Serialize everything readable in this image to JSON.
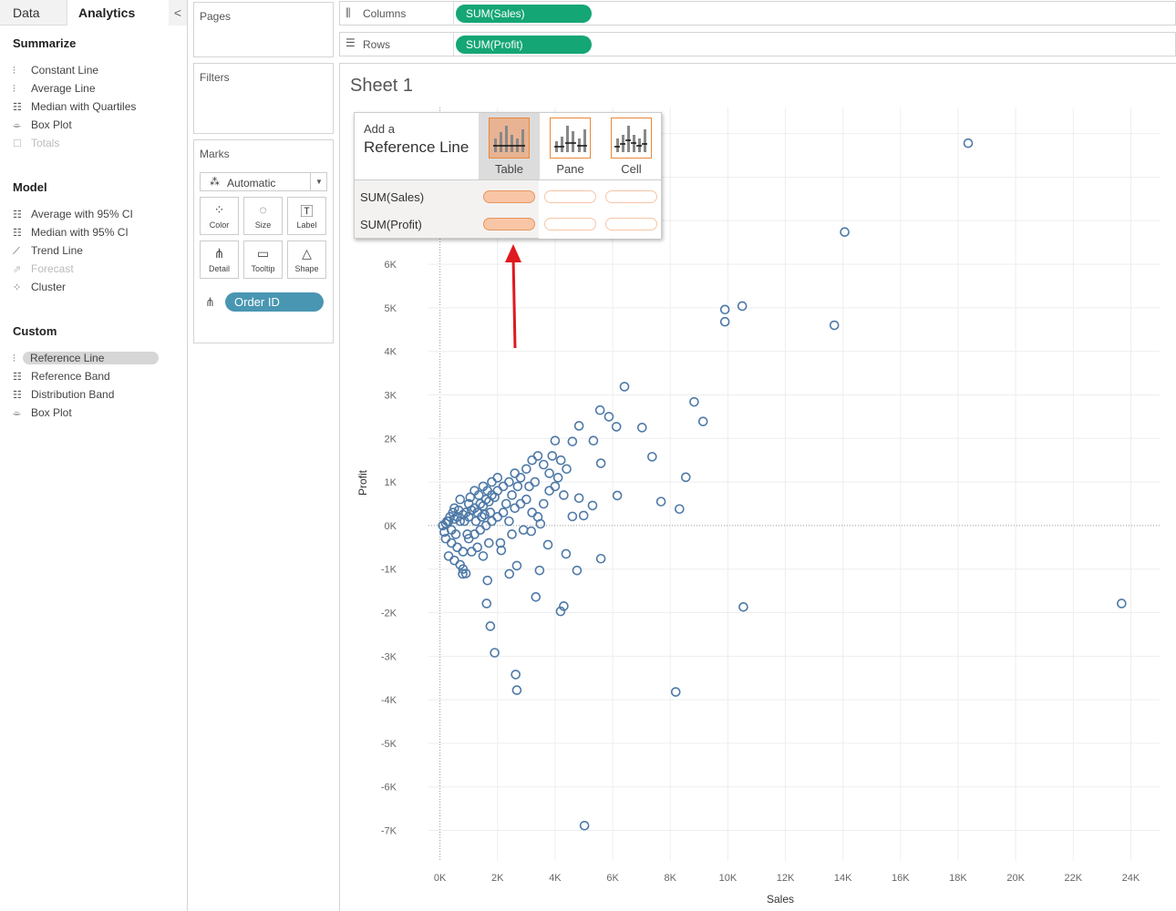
{
  "left_panel": {
    "tabs": [
      "Data",
      "Analytics"
    ],
    "collapse": "<",
    "sections": [
      {
        "title": "Summarize",
        "items": [
          {
            "icon": "constant-line-icon",
            "glyph": "⫶",
            "label": "Constant Line"
          },
          {
            "icon": "average-line-icon",
            "glyph": "⫶",
            "label": "Average Line"
          },
          {
            "icon": "median-quartiles-icon",
            "glyph": "☷",
            "label": "Median with Quartiles"
          },
          {
            "icon": "box-plot-icon",
            "glyph": "⌯",
            "label": "Box Plot"
          },
          {
            "icon": "totals-icon",
            "glyph": "☐",
            "label": "Totals",
            "disabled": true
          }
        ]
      },
      {
        "title": "Model",
        "items": [
          {
            "icon": "average-ci-icon",
            "glyph": "☷",
            "label": "Average with 95% CI"
          },
          {
            "icon": "median-ci-icon",
            "glyph": "☷",
            "label": "Median with 95% CI"
          },
          {
            "icon": "trend-line-icon",
            "glyph": "⟋",
            "label": "Trend Line"
          },
          {
            "icon": "forecast-icon",
            "glyph": "⇗",
            "label": "Forecast",
            "disabled": true
          },
          {
            "icon": "cluster-icon",
            "glyph": "⁘",
            "label": "Cluster"
          }
        ]
      },
      {
        "title": "Custom",
        "items": [
          {
            "icon": "reference-line-icon",
            "glyph": "⫶",
            "label": "Reference Line",
            "selected": true
          },
          {
            "icon": "reference-band-icon",
            "glyph": "☷",
            "label": "Reference Band"
          },
          {
            "icon": "distribution-band-icon",
            "glyph": "☷",
            "label": "Distribution Band"
          },
          {
            "icon": "box-plot-icon",
            "glyph": "⌯",
            "label": "Box Plot"
          }
        ]
      }
    ]
  },
  "cards": {
    "pages": "Pages",
    "filters": "Filters",
    "marks": "Marks",
    "mark_type": "Automatic",
    "buttons": [
      {
        "name": "color",
        "label": "Color",
        "glyph": "⁘"
      },
      {
        "name": "size",
        "label": "Size",
        "glyph": "◌"
      },
      {
        "name": "label",
        "label": "Label",
        "glyph": "🅃"
      },
      {
        "name": "detail",
        "label": "Detail",
        "glyph": "⋔"
      },
      {
        "name": "tooltip",
        "label": "Tooltip",
        "glyph": "▭"
      },
      {
        "name": "shape",
        "label": "Shape",
        "glyph": "△"
      }
    ],
    "detail_field": "Order ID"
  },
  "shelves": {
    "columns_label": "Columns",
    "columns_pill": "SUM(Sales)",
    "rows_label": "Rows",
    "rows_pill": "SUM(Profit)"
  },
  "sheet_title": "Sheet 1",
  "popup": {
    "line1": "Add a",
    "line2": "Reference Line",
    "scopes": [
      "Table",
      "Pane",
      "Cell"
    ],
    "selected_scope": "Table",
    "measures": [
      "SUM(Sales)",
      "SUM(Profit)"
    ]
  },
  "colors": {
    "mark": "#4e79a7",
    "pill_green": "#15a675",
    "pill_blue": "#4996b2",
    "accent": "#e8883a",
    "arrow": "#e0191f"
  },
  "chart_data": {
    "type": "scatter",
    "xlabel": "Sales",
    "ylabel": "Profit",
    "xlim": [
      -0.4,
      25
    ],
    "ylim": [
      -7.7,
      9.6
    ],
    "x_ticks": [
      "0K",
      "2K",
      "4K",
      "6K",
      "8K",
      "10K",
      "12K",
      "14K",
      "16K",
      "18K",
      "20K",
      "22K",
      "24K"
    ],
    "y_ticks": [
      "-7K",
      "-6K",
      "-5K",
      "-4K",
      "-3K",
      "-2K",
      "-1K",
      "0K",
      "1K",
      "2K",
      "3K",
      "4K",
      "5K",
      "6K"
    ],
    "units": "thousands",
    "points": [
      [
        18.35,
        8.78
      ],
      [
        14.06,
        6.74
      ],
      [
        9.9,
        4.96
      ],
      [
        10.5,
        5.04
      ],
      [
        9.9,
        4.68
      ],
      [
        13.7,
        4.6
      ],
      [
        6.41,
        3.19
      ],
      [
        8.83,
        2.84
      ],
      [
        9.14,
        2.39
      ],
      [
        5.56,
        2.65
      ],
      [
        5.87,
        2.5
      ],
      [
        4.83,
        2.29
      ],
      [
        6.13,
        2.27
      ],
      [
        7.02,
        2.25
      ],
      [
        7.37,
        1.58
      ],
      [
        4.0,
        1.95
      ],
      [
        4.6,
        1.93
      ],
      [
        5.33,
        1.95
      ],
      [
        8.54,
        1.11
      ],
      [
        5.59,
        1.43
      ],
      [
        6.16,
        0.69
      ],
      [
        7.68,
        0.55
      ],
      [
        8.32,
        0.38
      ],
      [
        5.3,
        0.46
      ],
      [
        4.83,
        0.63
      ],
      [
        4.99,
        0.23
      ],
      [
        4.6,
        0.21
      ],
      [
        10.54,
        -1.87
      ],
      [
        23.68,
        -1.79
      ],
      [
        5.59,
        -0.76
      ],
      [
        4.76,
        -1.03
      ],
      [
        4.38,
        -0.65
      ],
      [
        3.46,
        -1.03
      ],
      [
        3.33,
        -1.64
      ],
      [
        4.3,
        -1.85
      ],
      [
        4.19,
        -1.97
      ],
      [
        1.62,
        -1.79
      ],
      [
        1.75,
        -2.31
      ],
      [
        1.9,
        -2.92
      ],
      [
        2.63,
        -3.42
      ],
      [
        2.67,
        -3.78
      ],
      [
        8.19,
        -3.82
      ],
      [
        5.02,
        -6.89
      ],
      [
        3.75,
        -0.44
      ],
      [
        3.17,
        -0.13
      ],
      [
        2.67,
        -0.92
      ],
      [
        2.41,
        -1.11
      ],
      [
        1.65,
        -1.26
      ],
      [
        0.79,
        -1.11
      ],
      [
        2.13,
        -0.57
      ],
      [
        3.49,
        0.04
      ],
      [
        0.1,
        0
      ],
      [
        0.2,
        0.05
      ],
      [
        0.3,
        0.1
      ],
      [
        0.4,
        -0.1
      ],
      [
        0.5,
        0.15
      ],
      [
        0.6,
        0.2
      ],
      [
        0.7,
        0.1
      ],
      [
        0.8,
        0.25
      ],
      [
        0.9,
        0.3
      ],
      [
        1.0,
        0.2
      ],
      [
        1.1,
        0.35
      ],
      [
        1.2,
        0.4
      ],
      [
        1.3,
        0.3
      ],
      [
        1.4,
        0.5
      ],
      [
        1.5,
        0.45
      ],
      [
        1.6,
        0.6
      ],
      [
        1.7,
        0.55
      ],
      [
        1.8,
        0.7
      ],
      [
        1.9,
        0.65
      ],
      [
        2.0,
        0.8
      ],
      [
        2.2,
        0.9
      ],
      [
        2.4,
        1.0
      ],
      [
        2.6,
        1.2
      ],
      [
        2.8,
        1.1
      ],
      [
        3.0,
        1.3
      ],
      [
        3.2,
        1.5
      ],
      [
        3.4,
        1.6
      ],
      [
        3.6,
        1.4
      ],
      [
        3.8,
        1.2
      ],
      [
        4.2,
        1.5
      ],
      [
        4.4,
        1.3
      ],
      [
        0.2,
        -0.3
      ],
      [
        0.4,
        -0.4
      ],
      [
        0.6,
        -0.5
      ],
      [
        0.8,
        -0.6
      ],
      [
        1.0,
        -0.3
      ],
      [
        1.2,
        -0.2
      ],
      [
        1.4,
        -0.1
      ],
      [
        1.6,
        0.0
      ],
      [
        1.8,
        0.1
      ],
      [
        2.0,
        0.2
      ],
      [
        2.2,
        0.3
      ],
      [
        2.4,
        0.1
      ],
      [
        2.6,
        0.4
      ],
      [
        2.8,
        0.5
      ],
      [
        3.0,
        0.6
      ],
      [
        3.2,
        0.3
      ],
      [
        3.4,
        0.2
      ],
      [
        3.6,
        0.5
      ],
      [
        3.8,
        0.8
      ],
      [
        4.0,
        0.9
      ],
      [
        0.3,
        -0.7
      ],
      [
        0.5,
        -0.8
      ],
      [
        0.7,
        -0.9
      ],
      [
        0.9,
        -1.1
      ],
      [
        0.8,
        -1.0
      ],
      [
        1.1,
        -0.6
      ],
      [
        1.3,
        -0.5
      ],
      [
        1.5,
        -0.7
      ],
      [
        1.7,
        -0.4
      ],
      [
        2.1,
        -0.4
      ],
      [
        2.5,
        -0.2
      ],
      [
        2.9,
        -0.1
      ],
      [
        1.0,
        0.5
      ],
      [
        1.5,
        0.9
      ],
      [
        2.0,
        1.1
      ],
      [
        2.5,
        0.7
      ],
      [
        3.1,
        0.9
      ],
      [
        0.5,
        0.4
      ],
      [
        0.7,
        0.6
      ],
      [
        1.2,
        0.8
      ],
      [
        1.8,
        1.0
      ],
      [
        2.3,
        0.5
      ],
      [
        2.7,
        0.9
      ],
      [
        3.3,
        1.0
      ],
      [
        3.9,
        1.6
      ],
      [
        4.1,
        1.1
      ],
      [
        4.3,
        0.7
      ],
      [
        0.15,
        -0.15
      ],
      [
        0.35,
        0.2
      ],
      [
        0.25,
        0.1
      ],
      [
        0.45,
        0.3
      ],
      [
        0.55,
        -0.2
      ],
      [
        0.65,
        0.35
      ],
      [
        0.85,
        0.1
      ],
      [
        0.95,
        -0.2
      ],
      [
        1.05,
        0.65
      ],
      [
        1.25,
        0.1
      ],
      [
        1.35,
        0.7
      ],
      [
        1.45,
        0.2
      ],
      [
        1.55,
        0.25
      ],
      [
        1.65,
        0.8
      ],
      [
        1.75,
        0.3
      ]
    ]
  }
}
